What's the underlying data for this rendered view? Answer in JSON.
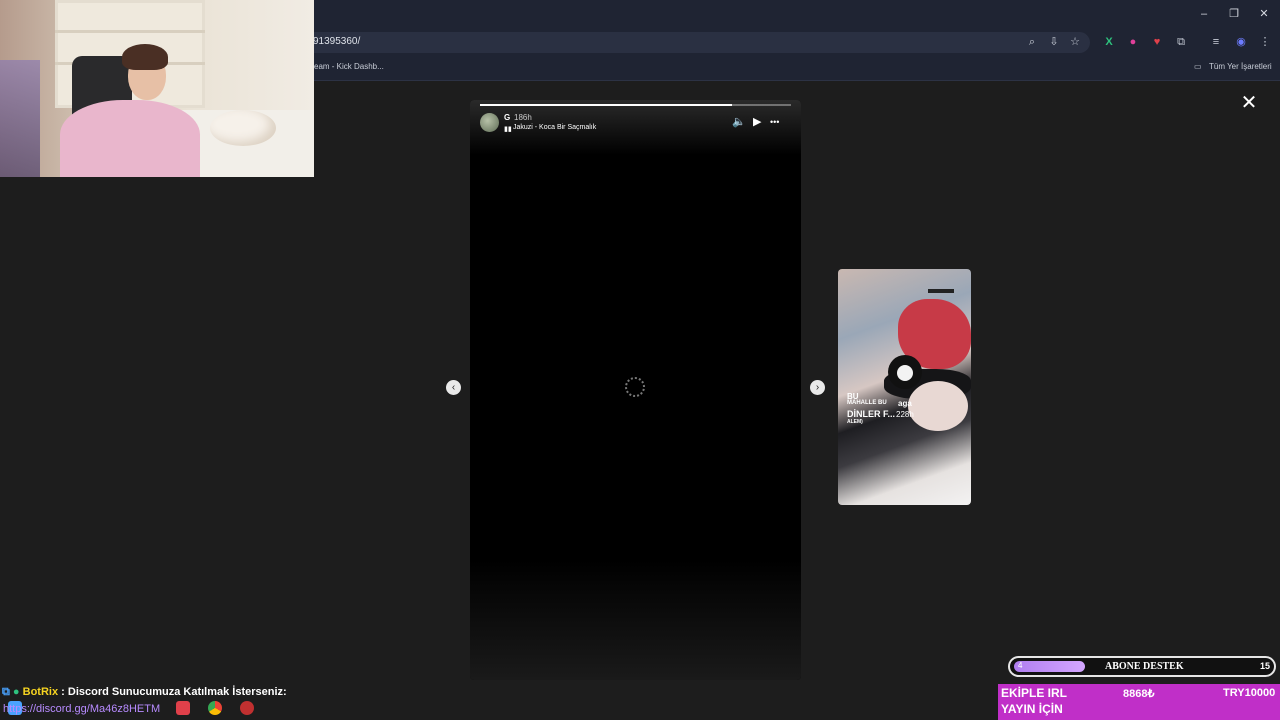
{
  "browser": {
    "url": "91395360/",
    "bookmark_left": "eam - Kick Dashb...",
    "bookmark_right": "Tüm Yer İşaretleri",
    "window_controls": {
      "minimize": "–",
      "restore": "❐",
      "close": "✕"
    },
    "toolbar_icons": [
      "zoom-icon",
      "install-icon",
      "star-icon",
      "extension-x-icon",
      "extension-pink-icon",
      "extension-red-icon",
      "extensions-icon",
      "media-icon",
      "profile-icon",
      "menu-icon"
    ]
  },
  "story": {
    "user_name": "G",
    "time": "186h",
    "music": "Jakuzi - Koca Bir Saçmalık",
    "progress": 0.81,
    "controls": {
      "mute": "🔈",
      "play": "▶",
      "more": "•••"
    },
    "close": "✕",
    "prev": "‹",
    "next": "›"
  },
  "next_preview": {
    "line1": "BU",
    "line2": "MAHALLE BU",
    "line3": "DİNLER F...",
    "line4": "ALEM)",
    "tag": "aga",
    "time": "228h"
  },
  "stream_overlay": {
    "chat_user": "BotRix",
    "chat_message": " : Discord Sunucumuza Katılmak İsterseniz:",
    "discord_link": "https://discord.gg/Ma46z8HETM",
    "abone": {
      "left_value": "4",
      "label": "ABONE DESTEK",
      "right_value": "15",
      "progress": 0.27
    },
    "promo": {
      "line1": "EKİPLE IRL",
      "line2": "YAYIN İÇİN",
      "amount": "8868₺",
      "goal": "TRY10000"
    }
  },
  "colors": {
    "page_bg": "#1d1d1d",
    "chrome_bg": "#1f2433",
    "promo": "#c02fc8",
    "chat_name": "#f5d321",
    "link": "#b78bff"
  }
}
